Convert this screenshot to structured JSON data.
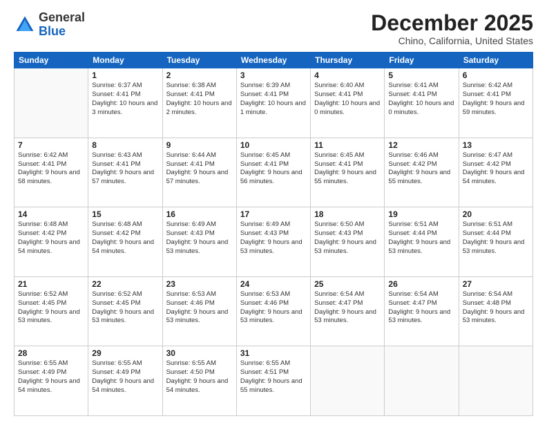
{
  "header": {
    "logo_general": "General",
    "logo_blue": "Blue",
    "month_title": "December 2025",
    "location": "Chino, California, United States"
  },
  "weekdays": [
    "Sunday",
    "Monday",
    "Tuesday",
    "Wednesday",
    "Thursday",
    "Friday",
    "Saturday"
  ],
  "weeks": [
    [
      {
        "day": null
      },
      {
        "day": "1",
        "sunrise": "Sunrise: 6:37 AM",
        "sunset": "Sunset: 4:41 PM",
        "daylight": "Daylight: 10 hours and 3 minutes."
      },
      {
        "day": "2",
        "sunrise": "Sunrise: 6:38 AM",
        "sunset": "Sunset: 4:41 PM",
        "daylight": "Daylight: 10 hours and 2 minutes."
      },
      {
        "day": "3",
        "sunrise": "Sunrise: 6:39 AM",
        "sunset": "Sunset: 4:41 PM",
        "daylight": "Daylight: 10 hours and 1 minute."
      },
      {
        "day": "4",
        "sunrise": "Sunrise: 6:40 AM",
        "sunset": "Sunset: 4:41 PM",
        "daylight": "Daylight: 10 hours and 0 minutes."
      },
      {
        "day": "5",
        "sunrise": "Sunrise: 6:41 AM",
        "sunset": "Sunset: 4:41 PM",
        "daylight": "Daylight: 10 hours and 0 minutes."
      },
      {
        "day": "6",
        "sunrise": "Sunrise: 6:42 AM",
        "sunset": "Sunset: 4:41 PM",
        "daylight": "Daylight: 9 hours and 59 minutes."
      }
    ],
    [
      {
        "day": "7",
        "sunrise": "Sunrise: 6:42 AM",
        "sunset": "Sunset: 4:41 PM",
        "daylight": "Daylight: 9 hours and 58 minutes."
      },
      {
        "day": "8",
        "sunrise": "Sunrise: 6:43 AM",
        "sunset": "Sunset: 4:41 PM",
        "daylight": "Daylight: 9 hours and 57 minutes."
      },
      {
        "day": "9",
        "sunrise": "Sunrise: 6:44 AM",
        "sunset": "Sunset: 4:41 PM",
        "daylight": "Daylight: 9 hours and 57 minutes."
      },
      {
        "day": "10",
        "sunrise": "Sunrise: 6:45 AM",
        "sunset": "Sunset: 4:41 PM",
        "daylight": "Daylight: 9 hours and 56 minutes."
      },
      {
        "day": "11",
        "sunrise": "Sunrise: 6:45 AM",
        "sunset": "Sunset: 4:41 PM",
        "daylight": "Daylight: 9 hours and 55 minutes."
      },
      {
        "day": "12",
        "sunrise": "Sunrise: 6:46 AM",
        "sunset": "Sunset: 4:42 PM",
        "daylight": "Daylight: 9 hours and 55 minutes."
      },
      {
        "day": "13",
        "sunrise": "Sunrise: 6:47 AM",
        "sunset": "Sunset: 4:42 PM",
        "daylight": "Daylight: 9 hours and 54 minutes."
      }
    ],
    [
      {
        "day": "14",
        "sunrise": "Sunrise: 6:48 AM",
        "sunset": "Sunset: 4:42 PM",
        "daylight": "Daylight: 9 hours and 54 minutes."
      },
      {
        "day": "15",
        "sunrise": "Sunrise: 6:48 AM",
        "sunset": "Sunset: 4:42 PM",
        "daylight": "Daylight: 9 hours and 54 minutes."
      },
      {
        "day": "16",
        "sunrise": "Sunrise: 6:49 AM",
        "sunset": "Sunset: 4:43 PM",
        "daylight": "Daylight: 9 hours and 53 minutes."
      },
      {
        "day": "17",
        "sunrise": "Sunrise: 6:49 AM",
        "sunset": "Sunset: 4:43 PM",
        "daylight": "Daylight: 9 hours and 53 minutes."
      },
      {
        "day": "18",
        "sunrise": "Sunrise: 6:50 AM",
        "sunset": "Sunset: 4:43 PM",
        "daylight": "Daylight: 9 hours and 53 minutes."
      },
      {
        "day": "19",
        "sunrise": "Sunrise: 6:51 AM",
        "sunset": "Sunset: 4:44 PM",
        "daylight": "Daylight: 9 hours and 53 minutes."
      },
      {
        "day": "20",
        "sunrise": "Sunrise: 6:51 AM",
        "sunset": "Sunset: 4:44 PM",
        "daylight": "Daylight: 9 hours and 53 minutes."
      }
    ],
    [
      {
        "day": "21",
        "sunrise": "Sunrise: 6:52 AM",
        "sunset": "Sunset: 4:45 PM",
        "daylight": "Daylight: 9 hours and 53 minutes."
      },
      {
        "day": "22",
        "sunrise": "Sunrise: 6:52 AM",
        "sunset": "Sunset: 4:45 PM",
        "daylight": "Daylight: 9 hours and 53 minutes."
      },
      {
        "day": "23",
        "sunrise": "Sunrise: 6:53 AM",
        "sunset": "Sunset: 4:46 PM",
        "daylight": "Daylight: 9 hours and 53 minutes."
      },
      {
        "day": "24",
        "sunrise": "Sunrise: 6:53 AM",
        "sunset": "Sunset: 4:46 PM",
        "daylight": "Daylight: 9 hours and 53 minutes."
      },
      {
        "day": "25",
        "sunrise": "Sunrise: 6:54 AM",
        "sunset": "Sunset: 4:47 PM",
        "daylight": "Daylight: 9 hours and 53 minutes."
      },
      {
        "day": "26",
        "sunrise": "Sunrise: 6:54 AM",
        "sunset": "Sunset: 4:47 PM",
        "daylight": "Daylight: 9 hours and 53 minutes."
      },
      {
        "day": "27",
        "sunrise": "Sunrise: 6:54 AM",
        "sunset": "Sunset: 4:48 PM",
        "daylight": "Daylight: 9 hours and 53 minutes."
      }
    ],
    [
      {
        "day": "28",
        "sunrise": "Sunrise: 6:55 AM",
        "sunset": "Sunset: 4:49 PM",
        "daylight": "Daylight: 9 hours and 54 minutes."
      },
      {
        "day": "29",
        "sunrise": "Sunrise: 6:55 AM",
        "sunset": "Sunset: 4:49 PM",
        "daylight": "Daylight: 9 hours and 54 minutes."
      },
      {
        "day": "30",
        "sunrise": "Sunrise: 6:55 AM",
        "sunset": "Sunset: 4:50 PM",
        "daylight": "Daylight: 9 hours and 54 minutes."
      },
      {
        "day": "31",
        "sunrise": "Sunrise: 6:55 AM",
        "sunset": "Sunset: 4:51 PM",
        "daylight": "Daylight: 9 hours and 55 minutes."
      },
      {
        "day": null
      },
      {
        "day": null
      },
      {
        "day": null
      }
    ]
  ]
}
